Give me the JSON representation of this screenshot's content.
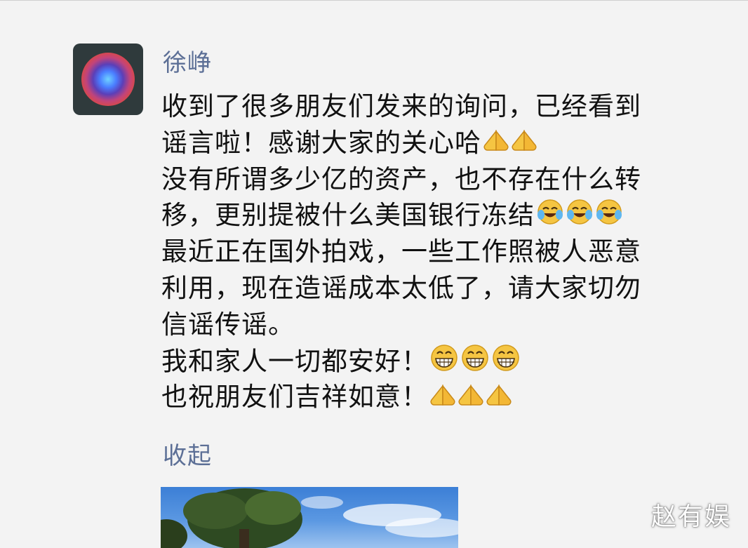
{
  "post": {
    "author": "徐峥",
    "lines": [
      {
        "text": "收到了很多朋友们发来的询问，已经看到",
        "emojis": []
      },
      {
        "text": "谣言啦！感谢大家的关心哈",
        "emojis": [
          "pray-hands-icon",
          "pray-hands-icon"
        ]
      },
      {
        "text": "没有所谓多少亿的资产，也不存在什么转",
        "emojis": []
      },
      {
        "text": "移，更别提被什么美国银行冻结",
        "emojis": [
          "laugh-cry-emoji-icon",
          "laugh-cry-emoji-icon",
          "laugh-cry-emoji-icon"
        ]
      },
      {
        "text": "最近正在国外拍戏，一些工作照被人恶意",
        "emojis": []
      },
      {
        "text": "利用，现在造谣成本太低了，请大家切勿",
        "emojis": []
      },
      {
        "text": "信谣传谣。",
        "emojis": []
      },
      {
        "text": "我和家人一切都安好！",
        "emojis": [
          "grin-emoji-icon",
          "grin-emoji-icon",
          "grin-emoji-icon"
        ]
      },
      {
        "text": "也祝朋友们吉祥如意！",
        "emojis": [
          "pray-hands-icon",
          "pray-hands-icon",
          "pray-hands-icon"
        ]
      }
    ],
    "collapse_label": "收起"
  },
  "watermark": "赵有娱",
  "colors": {
    "name_link": "#5c6f96",
    "body_text": "#111111",
    "background": "#f3f3f3",
    "emoji_yellow": "#f5c542"
  }
}
